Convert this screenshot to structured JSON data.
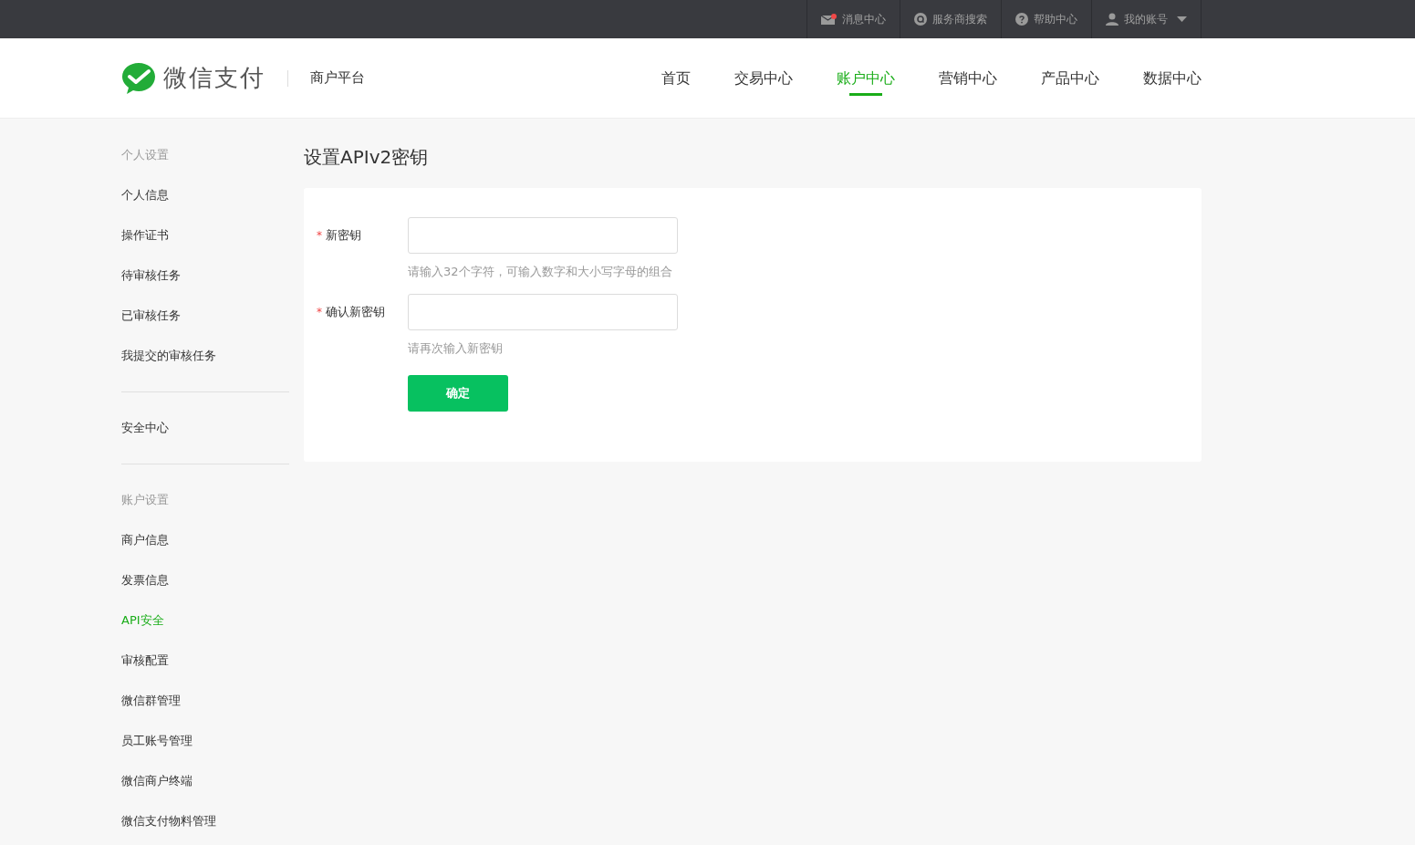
{
  "top_bar": {
    "items": [
      {
        "kind": "message",
        "label": "消息中心"
      },
      {
        "kind": "search",
        "label": "服务商搜索"
      },
      {
        "kind": "help",
        "label": "帮助中心"
      },
      {
        "kind": "account",
        "label": "我的账号"
      }
    ]
  },
  "header": {
    "brand": "微信支付",
    "platform": "商户平台",
    "nav": [
      {
        "label": "首页",
        "selected": false
      },
      {
        "label": "交易中心",
        "selected": false
      },
      {
        "label": "账户中心",
        "selected": true
      },
      {
        "label": "营销中心",
        "selected": false
      },
      {
        "label": "产品中心",
        "selected": false
      },
      {
        "label": "数据中心",
        "selected": false
      }
    ]
  },
  "sidebar": {
    "groups": [
      {
        "heading": "个人设置",
        "items": [
          {
            "label": "个人信息",
            "selected": false
          },
          {
            "label": "操作证书",
            "selected": false
          },
          {
            "label": "待审核任务",
            "selected": false
          },
          {
            "label": "已审核任务",
            "selected": false
          },
          {
            "label": "我提交的审核任务",
            "selected": false
          }
        ]
      },
      {
        "items": [
          {
            "label": "安全中心",
            "selected": false
          }
        ]
      },
      {
        "heading": "账户设置",
        "items": [
          {
            "label": "商户信息",
            "selected": false
          },
          {
            "label": "发票信息",
            "selected": false
          },
          {
            "label": "API安全",
            "selected": true
          },
          {
            "label": "审核配置",
            "selected": false
          },
          {
            "label": "微信群管理",
            "selected": false
          },
          {
            "label": "员工账号管理",
            "selected": false
          },
          {
            "label": "微信商户终端",
            "selected": false
          },
          {
            "label": "微信支付物料管理",
            "selected": false
          }
        ]
      }
    ]
  },
  "page": {
    "title": "设置APIv2密钥",
    "fields": [
      {
        "label": "新密钥",
        "mark": "*",
        "hint": "请输入32个字符，可输入数字和大小写字母的组合"
      },
      {
        "label": "确认新密钥",
        "mark": "*",
        "hint": "请再次输入新密钥"
      }
    ],
    "submit": "确定"
  }
}
